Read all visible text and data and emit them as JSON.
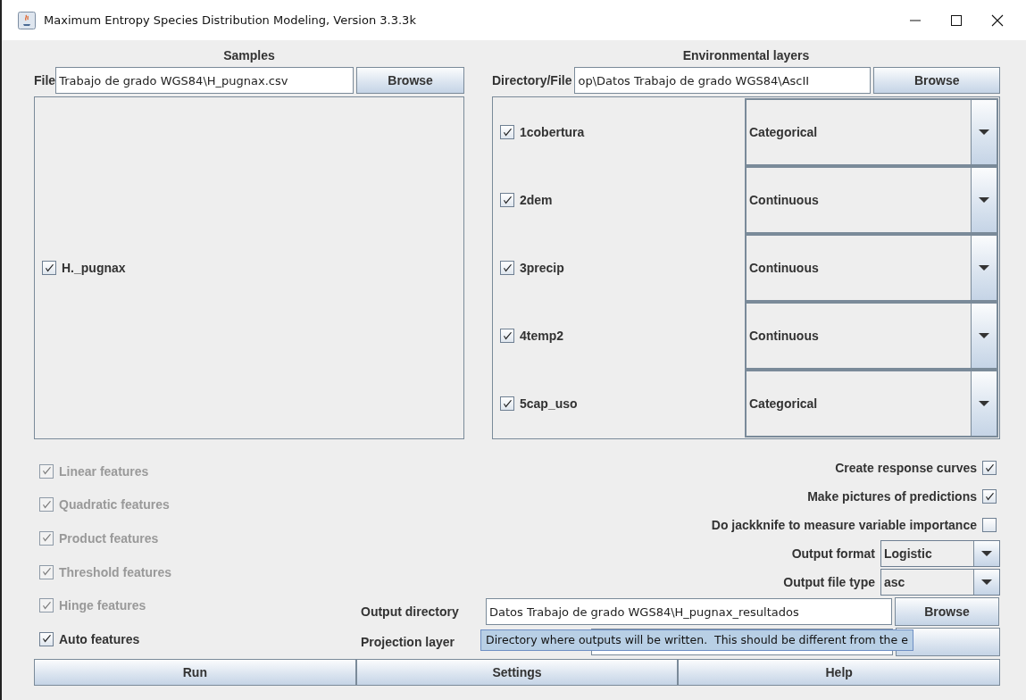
{
  "window": {
    "title": "Maximum Entropy Species Distribution Modeling, Version 3.3.3k"
  },
  "samples": {
    "heading": "Samples",
    "file_label": "File",
    "file_value": "Trabajo de grado WGS84\\H_pugnax.csv",
    "browse": "Browse",
    "species": [
      {
        "label": "H._pugnax",
        "checked": true
      }
    ]
  },
  "environmental_layers": {
    "heading": "Environmental layers",
    "file_label": "Directory/File",
    "file_value": "op\\Datos Trabajo de grado WGS84\\AscII",
    "browse": "Browse",
    "layers": [
      {
        "label": "1cobertura",
        "checked": true,
        "type": "Categorical"
      },
      {
        "label": "2dem",
        "checked": true,
        "type": "Continuous"
      },
      {
        "label": "3precip",
        "checked": true,
        "type": "Continuous"
      },
      {
        "label": "4temp2",
        "checked": true,
        "type": "Continuous"
      },
      {
        "label": "5cap_uso",
        "checked": true,
        "type": "Categorical"
      }
    ]
  },
  "features": [
    {
      "label": "Linear features",
      "checked": true,
      "disabled": true
    },
    {
      "label": "Quadratic features",
      "checked": true,
      "disabled": true
    },
    {
      "label": "Product features",
      "checked": true,
      "disabled": true
    },
    {
      "label": "Threshold features",
      "checked": true,
      "disabled": true
    },
    {
      "label": "Hinge features",
      "checked": true,
      "disabled": true
    },
    {
      "label": "Auto features",
      "checked": true,
      "disabled": false
    }
  ],
  "options": [
    {
      "kind": "checkbox",
      "label": "Create response curves",
      "checked": true
    },
    {
      "kind": "checkbox",
      "label": "Make pictures of predictions",
      "checked": true
    },
    {
      "kind": "checkbox",
      "label": "Do jackknife to measure variable importance",
      "checked": false
    },
    {
      "kind": "dropdown",
      "label": "Output format",
      "value": "Logistic"
    },
    {
      "kind": "dropdown",
      "label": "Output file type",
      "value": "asc"
    }
  ],
  "output_directory": {
    "label": "Output directory",
    "value": "Datos Trabajo de grado WGS84\\H_pugnax_resultados",
    "browse": "Browse"
  },
  "projection_layers": {
    "label": "Projection layer"
  },
  "tooltip": "Directory where outputs will be written.  This should be different from the e",
  "buttons": [
    "Run",
    "Settings",
    "Help"
  ]
}
